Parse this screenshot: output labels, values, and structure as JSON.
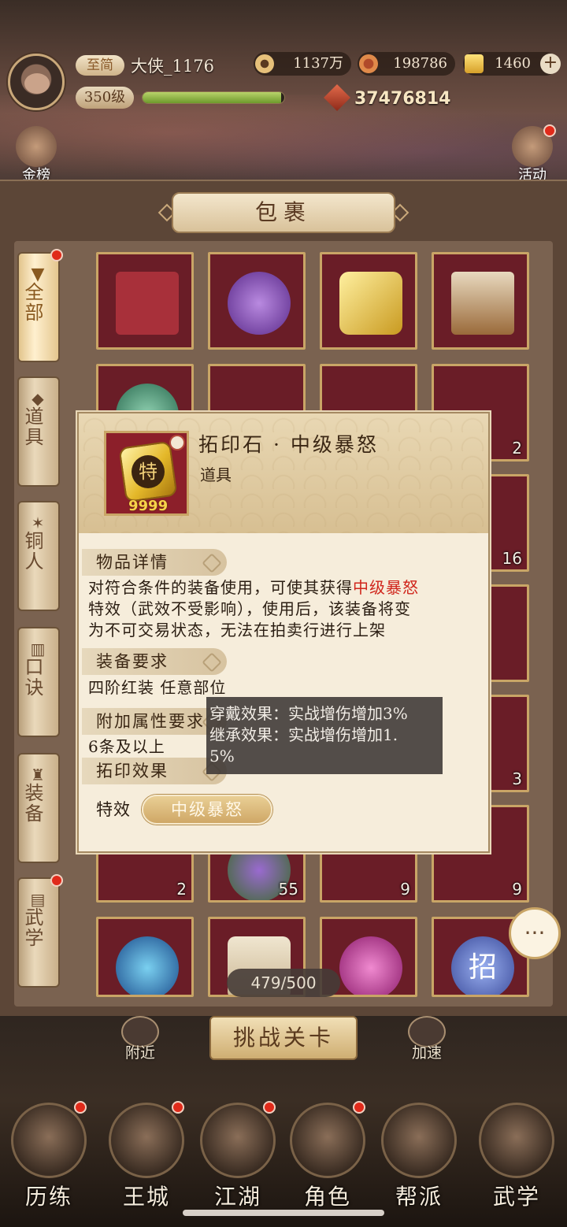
{
  "header": {
    "vip_label": "至简",
    "player_name": "大侠_1176",
    "level": "350级",
    "exp_progress": 0.98,
    "currency_coin": "1137万",
    "currency_copper": "198786",
    "currency_gold": "1460",
    "plus": "+",
    "power": "37476814",
    "top_left_icon_label": "金榜",
    "top_right_icon_label": "活动"
  },
  "bag": {
    "title": "包裹",
    "capacity": "479/500",
    "tabs": [
      {
        "label": "全部",
        "active": true,
        "dot": true
      },
      {
        "label": "道具",
        "active": false,
        "dot": false
      },
      {
        "label": "铜人",
        "active": false,
        "dot": false
      },
      {
        "label": "口诀",
        "active": false,
        "dot": false
      },
      {
        "label": "装备",
        "active": false,
        "dot": false
      },
      {
        "label": "武学",
        "active": false,
        "dot": true
      }
    ],
    "slot_counts": {
      "r2c4": "2",
      "r3c4": "16",
      "r5c4": "3",
      "r6c1": "2",
      "r6c2": "55",
      "r6c3": "9",
      "r6c4": "9"
    },
    "slot7_glyph": "招"
  },
  "popup": {
    "item_name": "拓印石 · 中级暴怒",
    "item_type": "道具",
    "item_icon_glyph": "特",
    "item_icon_qty": "9999",
    "section_detail": "物品详情",
    "detail_line1_pre": "对符合条件的装备使用，可使其获得",
    "detail_line1_hl": "中级暴怒",
    "detail_line2": "特效（武效不受影响），使用后，该装备将变",
    "detail_line3": "为不可交易状态，无法在拍卖行进行上架",
    "section_equip_req": "装备要求",
    "equip_req_text": "四阶红装  任意部位",
    "section_attr_req": "附加属性要求",
    "attr_req_text": "6条及以上",
    "section_effect": "拓印效果",
    "effect_label": "特效",
    "effect_value": "中级暴怒",
    "tooltip_line1": "穿戴效果：实战增伤增加3%",
    "tooltip_line2": "继承效果：实战增伤增加1.",
    "tooltip_line3": "5%"
  },
  "bottom": {
    "challenge_label": "挑战关卡",
    "nearby_label": "附近",
    "speedup_label": "加速",
    "nav": [
      "历练",
      "王城",
      "江湖",
      "角色",
      "帮派",
      "武学"
    ]
  },
  "colors": {
    "accent_red": "#d0261c",
    "slot_bg": "#6a1d27",
    "slot_border": "#c9a566",
    "panel_bg": "#f6eddb"
  }
}
